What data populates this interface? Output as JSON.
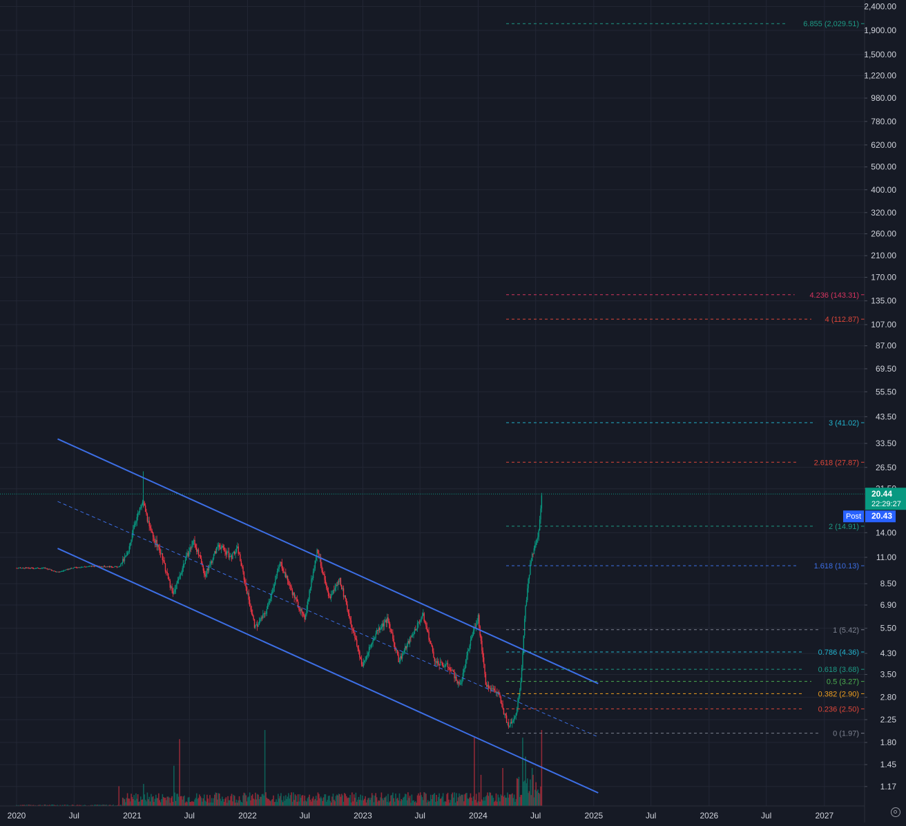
{
  "chart_data": {
    "type": "candlestick",
    "y_scale": "log",
    "grid": true,
    "x_axis": {
      "ticks": [
        {
          "label": "2020",
          "date": "2020-01-01"
        },
        {
          "label": "Jul",
          "date": "2020-07-01"
        },
        {
          "label": "2021",
          "date": "2021-01-01"
        },
        {
          "label": "Jul",
          "date": "2021-07-01"
        },
        {
          "label": "2022",
          "date": "2022-01-01"
        },
        {
          "label": "Jul",
          "date": "2022-07-01"
        },
        {
          "label": "2023",
          "date": "2023-01-01"
        },
        {
          "label": "Jul",
          "date": "2023-07-01"
        },
        {
          "label": "2024",
          "date": "2024-01-01"
        },
        {
          "label": "Jul",
          "date": "2024-07-01"
        },
        {
          "label": "2025",
          "date": "2025-01-01"
        },
        {
          "label": "Jul",
          "date": "2025-07-01"
        },
        {
          "label": "2026",
          "date": "2026-01-01"
        },
        {
          "label": "Jul",
          "date": "2026-07-01"
        },
        {
          "label": "2027",
          "date": "2027-01-01"
        }
      ]
    },
    "y_axis": {
      "ticks": [
        "2,400.00",
        "1,900.00",
        "1,500.00",
        "1,220.00",
        "980.00",
        "780.00",
        "620.00",
        "500.00",
        "400.00",
        "320.00",
        "260.00",
        "210.00",
        "170.00",
        "135.00",
        "107.00",
        "87.00",
        "69.50",
        "55.50",
        "43.50",
        "33.50",
        "26.50",
        "21.50",
        "14.00",
        "11.00",
        "8.50",
        "6.90",
        "5.50",
        "4.30",
        "3.50",
        "2.80",
        "2.25",
        "1.80",
        "1.45",
        "1.17"
      ],
      "range": [
        1.02,
        2580
      ]
    },
    "price_path": [
      {
        "date": "2020-01-01",
        "price": 9.9
      },
      {
        "date": "2020-04-01",
        "price": 9.9
      },
      {
        "date": "2020-05-10",
        "price": 9.5
      },
      {
        "date": "2020-07-01",
        "price": 9.95
      },
      {
        "date": "2020-09-01",
        "price": 10.1
      },
      {
        "date": "2020-11-20",
        "price": 10.0
      },
      {
        "date": "2020-12-20",
        "price": 11.5
      },
      {
        "date": "2021-01-05",
        "price": 15.0
      },
      {
        "date": "2021-02-05",
        "price": 19.0
      },
      {
        "date": "2021-02-25",
        "price": 14.5
      },
      {
        "date": "2021-04-01",
        "price": 11.5
      },
      {
        "date": "2021-05-10",
        "price": 7.6
      },
      {
        "date": "2021-06-15",
        "price": 10.5
      },
      {
        "date": "2021-07-15",
        "price": 13.0
      },
      {
        "date": "2021-08-20",
        "price": 9.2
      },
      {
        "date": "2021-10-01",
        "price": 12.5
      },
      {
        "date": "2021-11-10",
        "price": 11.0
      },
      {
        "date": "2021-12-01",
        "price": 12.0
      },
      {
        "date": "2021-12-25",
        "price": 8.5
      },
      {
        "date": "2022-01-25",
        "price": 5.5
      },
      {
        "date": "2022-03-01",
        "price": 6.5
      },
      {
        "date": "2022-04-15",
        "price": 10.5
      },
      {
        "date": "2022-05-20",
        "price": 8.0
      },
      {
        "date": "2022-06-30",
        "price": 6.0
      },
      {
        "date": "2022-08-10",
        "price": 12.0
      },
      {
        "date": "2022-09-15",
        "price": 7.3
      },
      {
        "date": "2022-10-20",
        "price": 8.9
      },
      {
        "date": "2022-11-20",
        "price": 6.1
      },
      {
        "date": "2022-12-31",
        "price": 3.8
      },
      {
        "date": "2023-02-15",
        "price": 5.4
      },
      {
        "date": "2023-03-20",
        "price": 6.0
      },
      {
        "date": "2023-04-25",
        "price": 4.0
      },
      {
        "date": "2023-06-01",
        "price": 5.0
      },
      {
        "date": "2023-07-10",
        "price": 6.3
      },
      {
        "date": "2023-08-20",
        "price": 3.9
      },
      {
        "date": "2023-10-01",
        "price": 3.8
      },
      {
        "date": "2023-11-05",
        "price": 3.1
      },
      {
        "date": "2023-12-10",
        "price": 5.0
      },
      {
        "date": "2024-01-01",
        "price": 6.2
      },
      {
        "date": "2024-01-25",
        "price": 3.2
      },
      {
        "date": "2024-03-05",
        "price": 2.9
      },
      {
        "date": "2024-04-05",
        "price": 2.1
      },
      {
        "date": "2024-04-30",
        "price": 2.4
      },
      {
        "date": "2024-05-15",
        "price": 3.3
      },
      {
        "date": "2024-05-30",
        "price": 6.8
      },
      {
        "date": "2024-06-15",
        "price": 10.5
      },
      {
        "date": "2024-07-01",
        "price": 12.5
      },
      {
        "date": "2024-07-10",
        "price": 13.5
      },
      {
        "date": "2024-07-20",
        "price": 20.44
      }
    ],
    "volume_spikes": [
      {
        "date": "2020-11-20",
        "volume": 2.6
      },
      {
        "date": "2021-02-05",
        "volume": 2.9
      },
      {
        "date": "2021-05-12",
        "volume": 5.3
      },
      {
        "date": "2021-06-01",
        "volume": 8.8
      },
      {
        "date": "2022-02-25",
        "volume": 10.0
      },
      {
        "date": "2023-12-20",
        "volume": 9.0
      },
      {
        "date": "2024-01-10",
        "volume": 4.1
      },
      {
        "date": "2024-03-20",
        "volume": 5.0
      },
      {
        "date": "2024-05-20",
        "volume": 9.0
      },
      {
        "date": "2024-05-30",
        "volume": 6.5
      },
      {
        "date": "2024-06-20",
        "volume": 5.0
      },
      {
        "date": "2024-07-20",
        "volume": 10.0
      }
    ],
    "channel": {
      "upper": {
        "start": {
          "date": "2020-05-10",
          "price": 35.0
        },
        "end": {
          "date": "2025-01-15",
          "price": 3.2
        }
      },
      "middle": {
        "start": {
          "date": "2020-05-10",
          "price": 19.0
        },
        "end": {
          "date": "2025-01-15",
          "price": 1.9
        }
      },
      "lower": {
        "start": {
          "date": "2020-05-10",
          "price": 12.0
        },
        "end": {
          "date": "2025-01-15",
          "price": 1.1
        }
      },
      "color": "#3d6fe6"
    },
    "fib_levels": [
      {
        "label": "6.855 (2,029.51)",
        "value": 2029.51,
        "color": "#1d9a85"
      },
      {
        "label": "4.236 (143.31)",
        "value": 143.31,
        "color": "#d8345f"
      },
      {
        "label": "4 (112.87)",
        "value": 112.87,
        "color": "#e0473a"
      },
      {
        "label": "3 (41.02)",
        "value": 41.02,
        "color": "#22b2cc"
      },
      {
        "label": "2.618 (27.87)",
        "value": 27.87,
        "color": "#e0473a"
      },
      {
        "label": "2 (14.91)",
        "value": 14.91,
        "color": "#1d9a85"
      },
      {
        "label": "1.618 (10.13)",
        "value": 10.13,
        "color": "#3d6fe6"
      },
      {
        "label": "1 (5.42)",
        "value": 5.42,
        "color": "#7d8290"
      },
      {
        "label": "0.786 (4.36)",
        "value": 4.36,
        "color": "#22b2cc"
      },
      {
        "label": "0.618 (3.68)",
        "value": 3.68,
        "color": "#1d9a85"
      },
      {
        "label": "0.5 (3.27)",
        "value": 3.27,
        "color": "#4caf50"
      },
      {
        "label": "0.382 (2.90)",
        "value": 2.9,
        "color": "#f0a020"
      },
      {
        "label": "0.236 (2.50)",
        "value": 2.5,
        "color": "#e0473a"
      },
      {
        "label": "0 (1.97)",
        "value": 1.97,
        "color": "#7d8290"
      }
    ],
    "last_price": {
      "value": 20.44,
      "label": "20.44",
      "countdown": "22:29:27",
      "color": "#089981"
    },
    "post_market": {
      "label": "Post",
      "value": "20.43",
      "color": "#2962ff"
    },
    "colors": {
      "up": "#089981",
      "down": "#f23645",
      "background": "#161a25"
    }
  }
}
